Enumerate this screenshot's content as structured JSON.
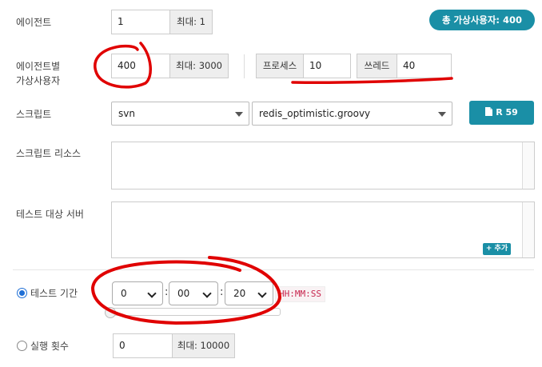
{
  "agent": {
    "label": "에이전트",
    "value": "1",
    "max_label": "최대: 1"
  },
  "total_vusers_badge": "총 가상사용자: 400",
  "vusers_per_agent": {
    "label_line1": "에이전트별",
    "label_line2": "가상사용자",
    "value": "400",
    "max_label": "최대: 3000",
    "process_label": "프로세스",
    "process_value": "10",
    "thread_label": "쓰레드",
    "thread_value": "40"
  },
  "script": {
    "label": "스크립트",
    "repo_select": "svn",
    "file_select": "redis_optimistic.groovy",
    "revision_button": "R 59",
    "icon": "document-icon"
  },
  "script_resources": {
    "label": "스크립트 리소스"
  },
  "target_hosts": {
    "label": "테스트 대상 서버",
    "add_button": "+ 추가"
  },
  "duration": {
    "label": "테스트 기간",
    "selected": true,
    "hours": "0",
    "minutes": "00",
    "seconds": "20",
    "separator": ":",
    "format_hint": "HH:MM:SS",
    "slider_level": 0
  },
  "run_count": {
    "label": "실행 횟수",
    "selected": false,
    "value": "0",
    "max_label": "최대: 10000"
  },
  "colors": {
    "accent": "#1a8fa6",
    "annotation": "#e00000"
  }
}
